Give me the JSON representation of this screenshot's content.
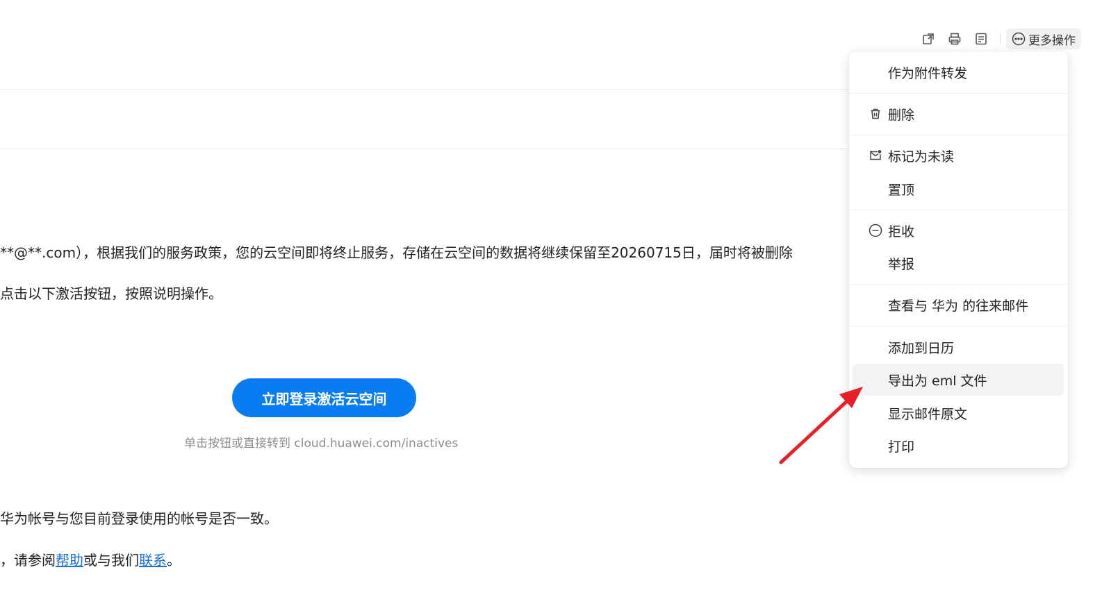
{
  "toolbar": {
    "icons": [
      "open-in-new-window-icon",
      "printer-icon",
      "note-icon"
    ],
    "more_label": "更多操作"
  },
  "body": {
    "line1": "**@**.com），根据我们的服务政策，您的云空间即将终止服务，存储在云空间的数据将继续保留至20260715日，届时将被删除",
    "line2": "点击以下激活按钮，按照说明操作。",
    "cta_label": "立即登录激活云空间",
    "cta_sub": "单击按钮或直接转到 cloud.huawei.com/inactives",
    "line3": "华为帐号与您目前登录使用的帐号是否一致。",
    "line4_prefix": "，请参阅",
    "help_link": "帮助",
    "line4_mid": "或与我们",
    "contact_link": "联系",
    "line4_suffix": "。"
  },
  "menu": {
    "items": [
      {
        "label": "作为附件转发",
        "icon": ""
      },
      {
        "label": "删除",
        "icon": "trash-icon"
      },
      {
        "label": "标记为未读",
        "icon": "mail-unread-icon"
      },
      {
        "label": "置顶",
        "icon": ""
      },
      {
        "label": "拒收",
        "icon": "block-icon"
      },
      {
        "label": "举报",
        "icon": ""
      },
      {
        "label": "查看与 华为 的往来邮件",
        "icon": ""
      },
      {
        "label": "添加到日历",
        "icon": ""
      },
      {
        "label": "导出为 eml 文件",
        "icon": "",
        "highlighted": true
      },
      {
        "label": "显示邮件原文",
        "icon": ""
      },
      {
        "label": "打印",
        "icon": ""
      }
    ]
  },
  "annotation": {
    "arrow_color": "#e8202a"
  },
  "colors": {
    "accent": "#0a7cf2",
    "link": "#1a6fd8"
  }
}
